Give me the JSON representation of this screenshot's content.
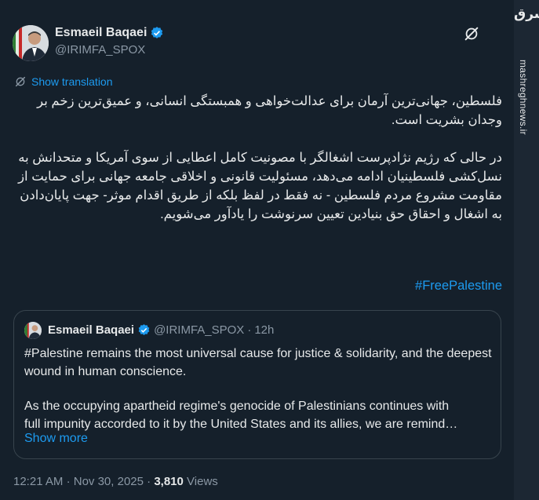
{
  "author": {
    "name": "Esmaeil Baqaei",
    "handle": "@IRIMFA_SPOX"
  },
  "translate_label": "Show translation",
  "body": {
    "paragraph_1": "فلسطین، جهانی‌ترین آرمان برای عدالت‌خواهی و همبستگی انسانی، و عمیق‌ترین زخم بر وجدان بشریت است.",
    "paragraph_2": "در حالی که رژیم نژادپرست اشغالگر با مصونیت کامل اعطایی از سوی آمریکا و متحدانش به نسل‌کشی فلسطینیان ادامه می‌دهد، مسئولیت قانونی و اخلاقی جامعه جهانی برای حمایت از مقاومت مشروع مردم فلسطین - نه فقط در لفظ بلکه از طریق اقدام موثر- جهت پایان‌دادن به اشغال و احقاق حق بنیادین  تعیین سرنوشت را یادآور می‌شویم.",
    "hashtag": "#FreePalestine"
  },
  "quote": {
    "name": "Esmaeil Baqaei",
    "handle": "@IRIMFA_SPOX",
    "separator": "·",
    "time": "12h",
    "text_1": "#Palestine remains the most universal cause for justice & solidarity, and the deepest wound in human conscience.",
    "text_2_line1": " As the occupying apartheid regime's genocide of Palestinians continues with",
    "text_2_line2": "full impunity accorded to it by the United States and its allies, we are remind…",
    "show_more": "Show more"
  },
  "footer": {
    "time": "12:21 AM",
    "dot1": "·",
    "date": "Nov 30, 2025",
    "dot2": "·",
    "views_count": "3,810",
    "views_label": "Views"
  },
  "watermark": {
    "logo": "مشرق",
    "site": "mashreghnews.ir"
  },
  "colors": {
    "background": "#15202b",
    "text": "#e7e9ea",
    "muted": "#8b98a5",
    "accent": "#1d9bf0",
    "border": "#38444d"
  },
  "icons": [
    "verified-badge-icon",
    "grok-icon",
    "translate-icon"
  ]
}
